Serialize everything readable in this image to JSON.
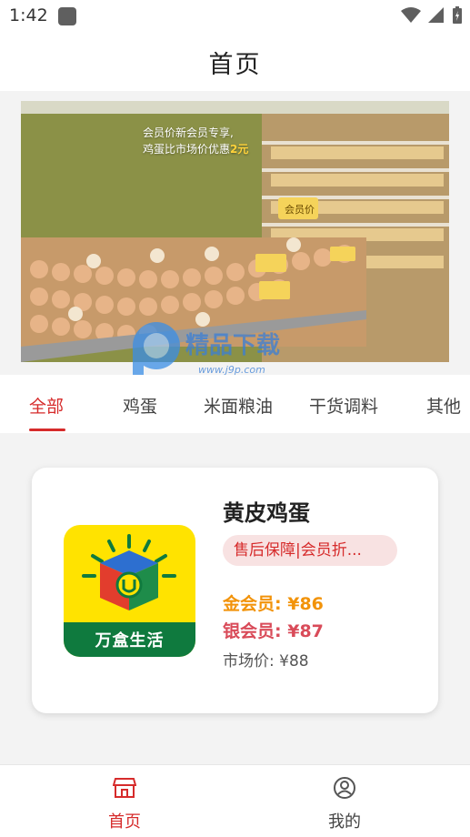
{
  "status_bar": {
    "time": "1:42"
  },
  "header": {
    "title": "首页"
  },
  "banner": {
    "line1": "会员价新会员专享,",
    "line2_prefix": "鸡蛋比市场价优惠",
    "line2_highlight": "2元",
    "shelf_sign": "会员价"
  },
  "watermark": {
    "text": "精品下载",
    "url": "www.j9p.com"
  },
  "tabs": [
    {
      "label": "全部"
    },
    {
      "label": "鸡蛋"
    },
    {
      "label": "米面粮油"
    },
    {
      "label": "干货调料"
    },
    {
      "label": "其他"
    }
  ],
  "product": {
    "title": "黄皮鸡蛋",
    "tag": "售后保障|会员折...",
    "logo_text": "万盒生活",
    "gold_label": "金会员:",
    "gold_price": "¥86",
    "silver_label": "银会员:",
    "silver_price": "¥87",
    "market_label": "市场价:",
    "market_price": "¥88"
  },
  "bottom_nav": [
    {
      "label": "首页"
    },
    {
      "label": "我的"
    }
  ],
  "colors": {
    "accent": "#d62b2b",
    "gold": "#f2930a",
    "silver": "#d94b59"
  }
}
